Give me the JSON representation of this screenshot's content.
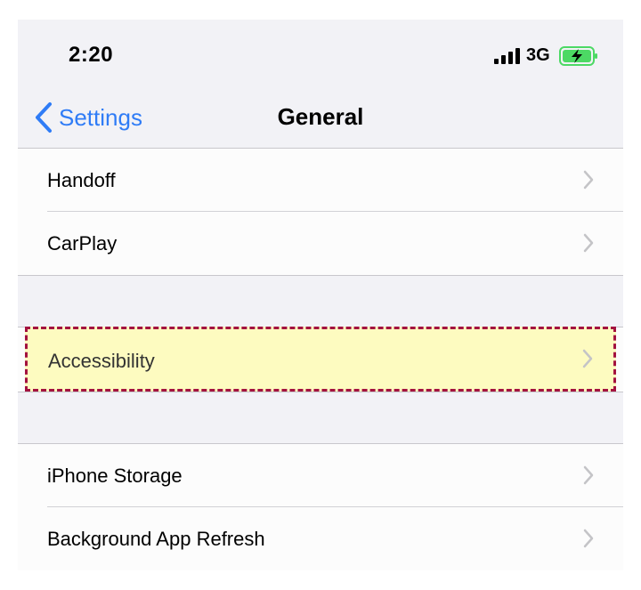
{
  "status_bar": {
    "time": "2:20",
    "network": "3G",
    "battery_color": "#4cd964"
  },
  "nav": {
    "back_label": "Settings",
    "title": "General",
    "accent_color": "#2f7cf6"
  },
  "groups": [
    {
      "items": [
        {
          "label": "Handoff"
        },
        {
          "label": "CarPlay"
        }
      ]
    },
    {
      "items": [
        {
          "label": "Accessibility",
          "highlighted": true
        }
      ]
    },
    {
      "items": [
        {
          "label": "iPhone Storage"
        },
        {
          "label": "Background App Refresh"
        }
      ]
    }
  ],
  "highlight": {
    "fill_color": "#fdfbc0",
    "border_color": "#a3123f"
  }
}
